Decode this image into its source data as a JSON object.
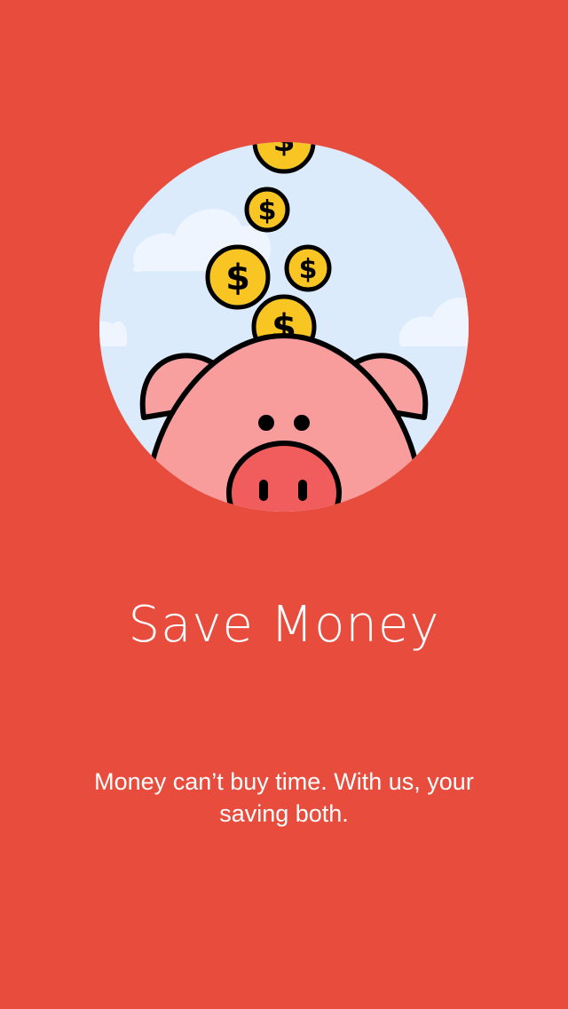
{
  "screen": {
    "title": "Save Money",
    "subtitle": "Money can’t buy time. With us, your saving both."
  },
  "illustration": {
    "coin_symbol": "$",
    "icons": [
      "piggy-bank-icon",
      "coin-icon",
      "cloud-icon"
    ]
  },
  "colors": {
    "background": "#E84C3D",
    "sky": "#DCEBFC",
    "cloud": "#EEF5FE",
    "pig_body": "#F89C9C",
    "pig_ear": "#F8A0A0",
    "pig_outline": "#000000",
    "snout": "#F15C5C",
    "coin": "#F8C523",
    "title_text": "#FFFFFF",
    "subtitle_text": "#FFFFFF"
  }
}
